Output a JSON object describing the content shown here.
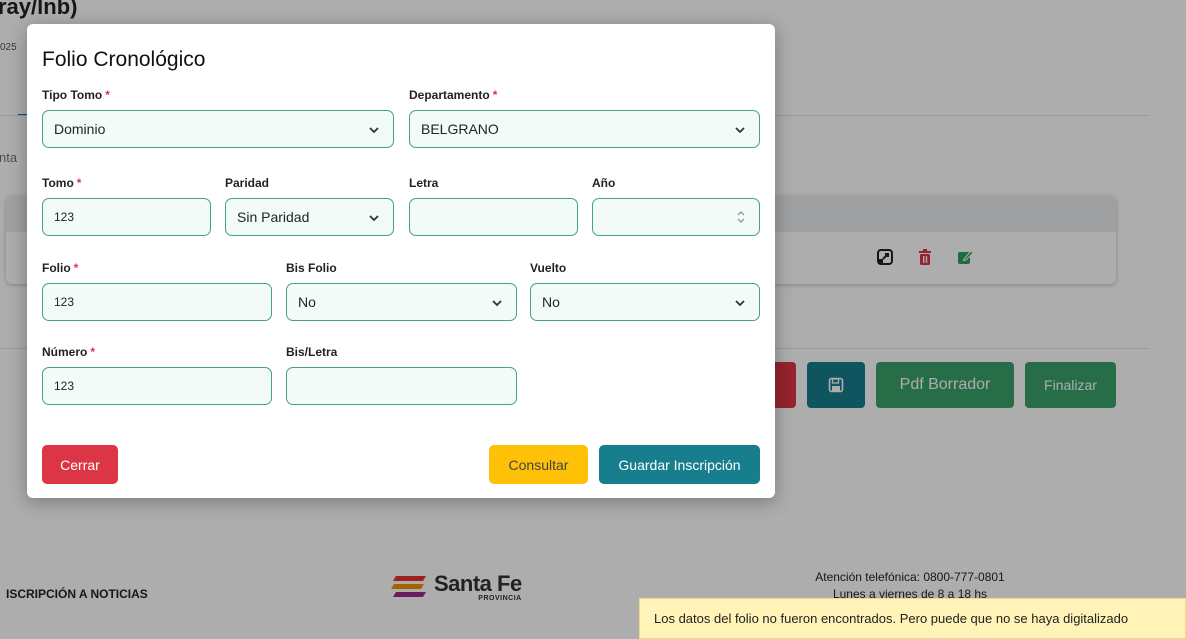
{
  "background": {
    "title_fragment": "ray/lnb)",
    "subtitle_fragment": "025",
    "side_text_fragment": "nta",
    "buttons": {
      "pdf_label": "Pdf Borrador",
      "finalize_label": "Finalizar"
    },
    "footer": {
      "newsletter_fragment": "ISCRIPCIÓN A NOTICIAS",
      "logo_name": "Santa Fe",
      "logo_sub": "PROVINCIA",
      "contact_line1": "Atención telefónica: 0800-777-0801",
      "contact_line2": "Lunes a viernes de 8 a 18 hs"
    }
  },
  "modal": {
    "title": "Folio Cronológico",
    "required_mark": "*",
    "fields": {
      "tipo_tomo": {
        "label": "Tipo Tomo",
        "value": "Dominio"
      },
      "departamento": {
        "label": "Departamento",
        "value": "BELGRANO"
      },
      "tomo": {
        "label": "Tomo",
        "value": "123"
      },
      "paridad": {
        "label": "Paridad",
        "value": "Sin Paridad"
      },
      "letra": {
        "label": "Letra",
        "value": ""
      },
      "anio": {
        "label": "Año",
        "value": ""
      },
      "folio": {
        "label": "Folio",
        "value": "123"
      },
      "bis_folio": {
        "label": "Bis Folio",
        "value": "No"
      },
      "vuelto": {
        "label": "Vuelto",
        "value": "No"
      },
      "numero": {
        "label": "Número",
        "value": "123"
      },
      "bis_letra": {
        "label": "Bis/Letra",
        "value": ""
      }
    },
    "buttons": {
      "close": "Cerrar",
      "consult": "Consultar",
      "save": "Guardar Inscripción"
    }
  },
  "toast": {
    "message": "Los datos del folio no fueron encontrados. Pero puede que no se haya digitalizado"
  },
  "colors": {
    "field_border": "#45a27a",
    "danger": "#dc3545",
    "warning": "#ffc107",
    "primary_teal": "#167e8c",
    "success": "#39a16b"
  }
}
